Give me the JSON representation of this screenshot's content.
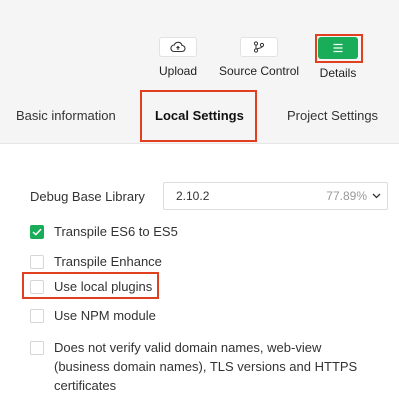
{
  "toolbar": {
    "upload": {
      "label": "Upload",
      "icon": "cloud-upload-icon"
    },
    "source_control": {
      "label": "Source Control",
      "icon": "git-branch-icon"
    },
    "details": {
      "label": "Details",
      "icon": "menu-icon"
    }
  },
  "tabs": [
    {
      "label": "Basic information",
      "active": false
    },
    {
      "label": "Local Settings",
      "active": true
    },
    {
      "label": "Project Settings",
      "active": false
    }
  ],
  "debug_library": {
    "label": "Debug Base Library",
    "version": "2.10.2",
    "percent": "77.89%"
  },
  "options": [
    {
      "label": "Transpile ES6 to ES5",
      "checked": true
    },
    {
      "label": "Transpile Enhance",
      "checked": false
    },
    {
      "label": "Use local plugins",
      "checked": false
    },
    {
      "label": "Use NPM module",
      "checked": false
    },
    {
      "label": "Does not verify valid domain names, web-view (business domain names), TLS versions and HTTPS certificates",
      "checked": false
    }
  ],
  "colors": {
    "accent": "#19ad5a",
    "highlight": "#e0401f"
  }
}
